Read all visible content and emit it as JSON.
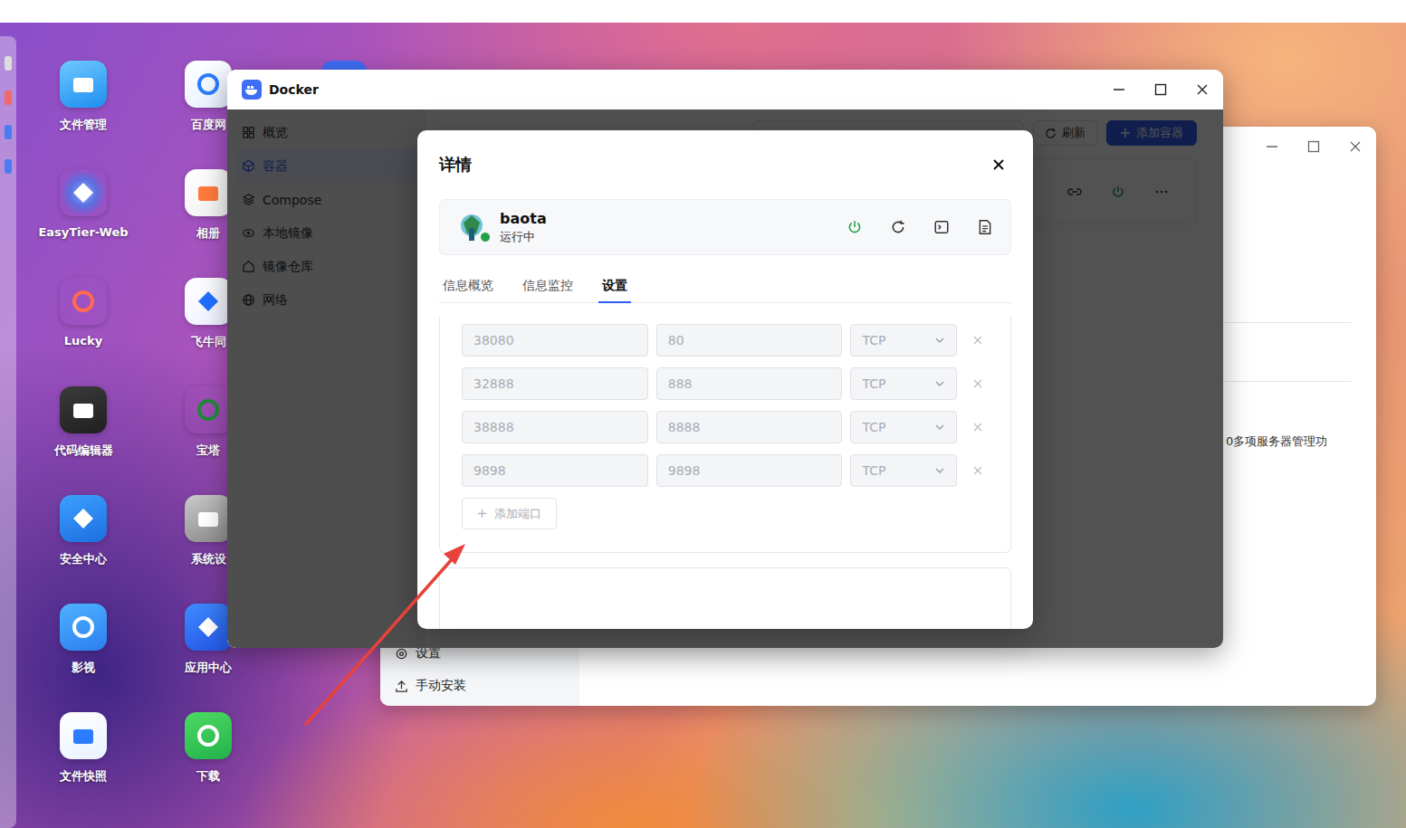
{
  "desktop": {
    "icons": [
      {
        "label": "文件管理"
      },
      {
        "label": "百度网"
      },
      {
        "label": "EasyTier-Web"
      },
      {
        "label": "相册"
      },
      {
        "label": "Lucky"
      },
      {
        "label": "飞牛同"
      },
      {
        "label": "代码编辑器"
      },
      {
        "label": "宝塔"
      },
      {
        "label": "安全中心"
      },
      {
        "label": "系统设"
      },
      {
        "label": "影视"
      },
      {
        "label": "应用中心"
      },
      {
        "label": "文件快照"
      },
      {
        "label": "下载"
      }
    ]
  },
  "app_center_window": {
    "sidebar_items": [
      {
        "label": "设置"
      },
      {
        "label": "手动安装"
      }
    ],
    "description": "0多项服务器管理功"
  },
  "docker_window": {
    "title": "Docker",
    "sidebar": [
      {
        "label": "概览",
        "selected": false
      },
      {
        "label": "容器",
        "selected": true
      },
      {
        "label": "Compose",
        "selected": false
      },
      {
        "label": "本地镜像",
        "selected": false
      },
      {
        "label": "镜像仓库",
        "selected": false
      },
      {
        "label": "网络",
        "selected": false
      }
    ],
    "toolbar": {
      "refresh": "刷新",
      "add": "添加容器"
    }
  },
  "dialog": {
    "title": "详情",
    "container": {
      "name": "baota",
      "status": "运行中",
      "running": true
    },
    "tabs": [
      {
        "label": "信息概览",
        "selected": false
      },
      {
        "label": "信息监控",
        "selected": false
      },
      {
        "label": "设置",
        "selected": true
      }
    ],
    "ports": [
      {
        "host": "38080",
        "container": "80",
        "protocol": "TCP"
      },
      {
        "host": "32888",
        "container": "888",
        "protocol": "TCP"
      },
      {
        "host": "38888",
        "container": "8888",
        "protocol": "TCP"
      },
      {
        "host": "9898",
        "container": "9898",
        "protocol": "TCP"
      }
    ],
    "add_port": "添加端口"
  }
}
